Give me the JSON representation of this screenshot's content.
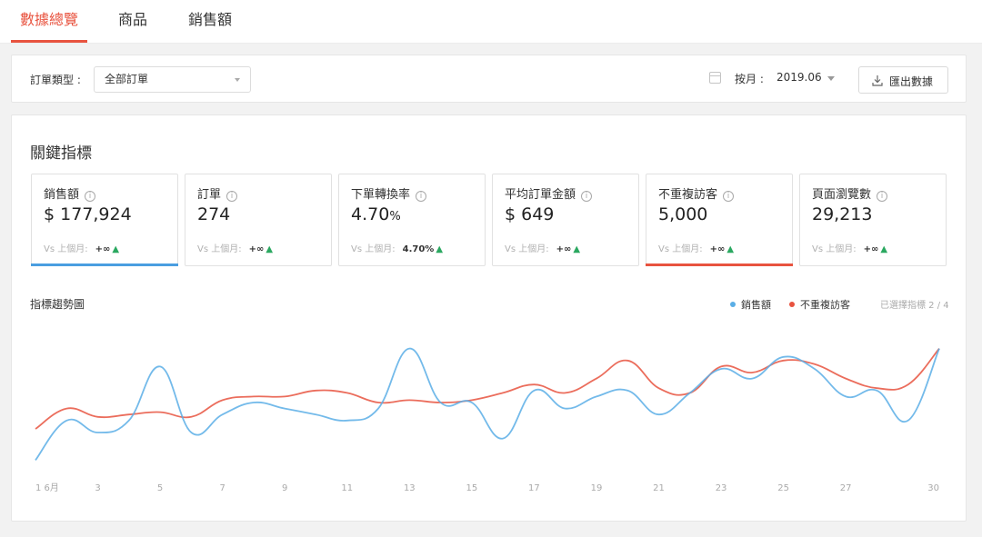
{
  "tabs": [
    {
      "label": "數據總覽",
      "active": true
    },
    {
      "label": "商品",
      "active": false
    },
    {
      "label": "銷售額",
      "active": false
    }
  ],
  "filter": {
    "order_type_label": "訂單類型 :",
    "order_type_value": "全部訂單",
    "month_label": "按月 :",
    "month_value": "2019.06",
    "export_label": "匯出數據"
  },
  "panel": {
    "title": "關鍵指標",
    "comparison_label": "Vs 上個月:"
  },
  "metrics": [
    {
      "name": "銷售額",
      "value": "$ 177,924",
      "unit": "",
      "delta": "+∞",
      "selected": true,
      "selected_color": "#4a9ee0"
    },
    {
      "name": "訂單",
      "value": "274",
      "unit": "",
      "delta": "+∞",
      "selected": false
    },
    {
      "name": "下單轉換率",
      "value": "4.70",
      "unit": "%",
      "delta": "4.70%",
      "selected": false
    },
    {
      "name": "平均訂單金額",
      "value": "$ 649",
      "unit": "",
      "delta": "+∞",
      "selected": false
    },
    {
      "name": "不重複訪客",
      "value": "5,000",
      "unit": "",
      "delta": "+∞",
      "selected": true,
      "selected_color": "#e8533f"
    },
    {
      "name": "頁面瀏覽數",
      "value": "29,213",
      "unit": "",
      "delta": "+∞",
      "selected": false
    }
  ],
  "trend": {
    "title": "指標趨勢圖",
    "selected_count": "已選擇指標 2 / 4"
  },
  "chart_data": {
    "type": "line",
    "x": [
      1,
      2,
      3,
      4,
      5,
      6,
      7,
      8,
      9,
      10,
      11,
      12,
      13,
      14,
      15,
      16,
      17,
      18,
      19,
      20,
      21,
      22,
      23,
      24,
      25,
      26,
      27,
      28,
      29,
      30
    ],
    "x_tick_labels": [
      "1 6月",
      "3",
      "5",
      "7",
      "9",
      "11",
      "13",
      "15",
      "17",
      "19",
      "21",
      "23",
      "25",
      "27",
      "30"
    ],
    "x_tick_positions": [
      1,
      3,
      5,
      7,
      9,
      11,
      13,
      15,
      17,
      19,
      21,
      23,
      25,
      27,
      30
    ],
    "ylim": [
      0,
      100
    ],
    "grid": false,
    "legend_position": "top-right",
    "series": [
      {
        "name": "銷售額",
        "color": "#5aaee6",
        "values": [
          2,
          35,
          25,
          35,
          80,
          25,
          40,
          50,
          45,
          40,
          35,
          45,
          95,
          50,
          50,
          20,
          60,
          45,
          55,
          60,
          40,
          58,
          78,
          70,
          88,
          78,
          55,
          60,
          35,
          95
        ]
      },
      {
        "name": "不重複訪客",
        "color": "#e8533f",
        "values": [
          28,
          45,
          38,
          40,
          42,
          38,
          52,
          55,
          55,
          60,
          58,
          50,
          52,
          50,
          52,
          58,
          65,
          58,
          70,
          85,
          62,
          58,
          80,
          75,
          85,
          82,
          70,
          62,
          65,
          95
        ]
      }
    ]
  }
}
